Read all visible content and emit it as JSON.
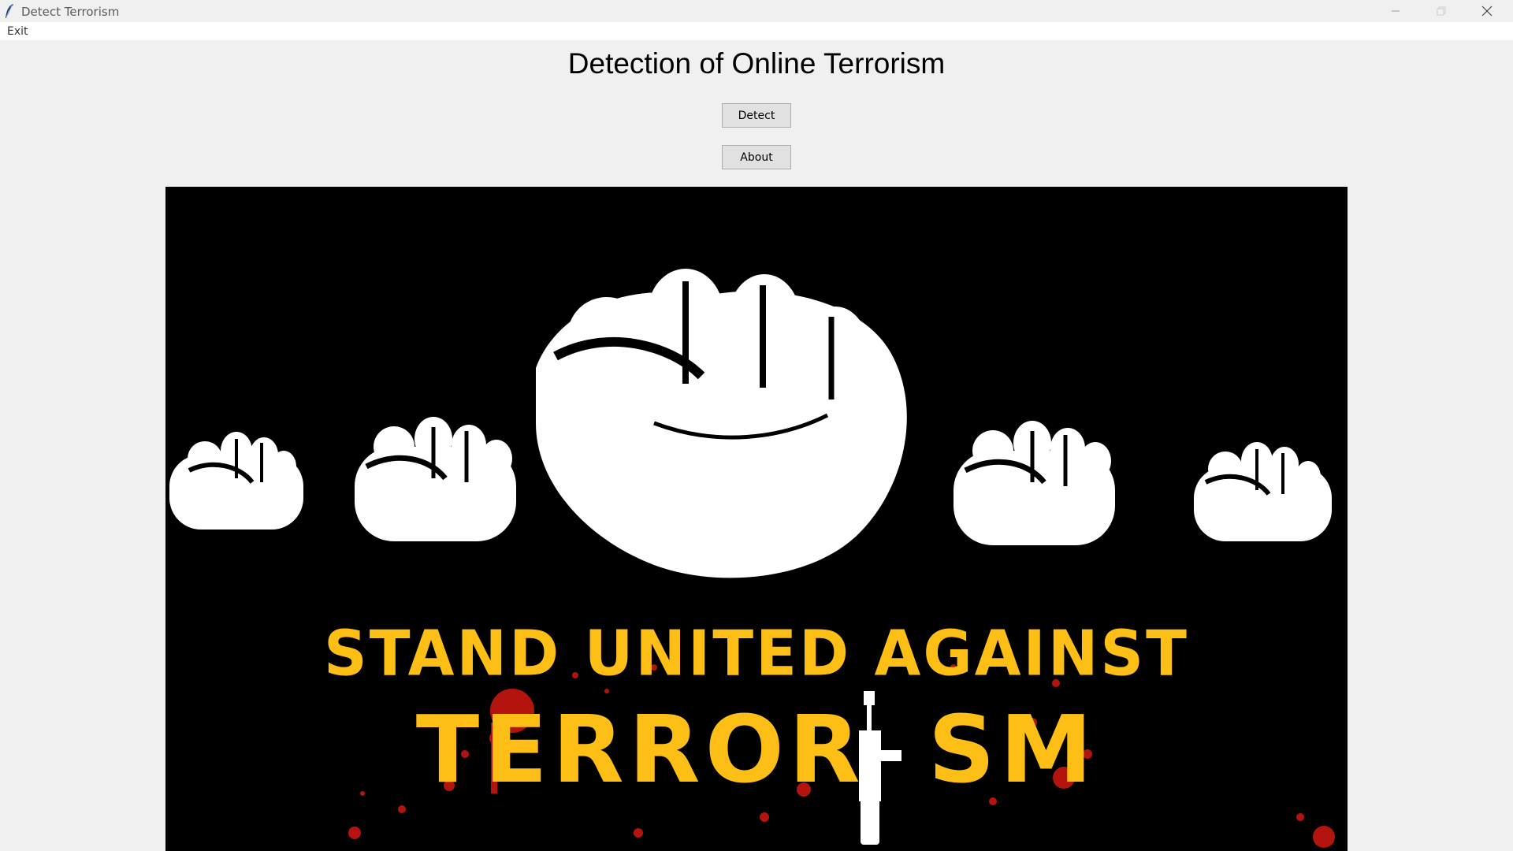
{
  "window": {
    "title": "Detect Terrorism",
    "app_icon": "feather-icon",
    "controls": [
      "minimize-icon",
      "maximize-icon",
      "close-icon"
    ]
  },
  "menubar": {
    "items": [
      {
        "label": "Exit"
      }
    ]
  },
  "main": {
    "heading": "Detection of Online Terrorism",
    "buttons": {
      "detect_label": "Detect",
      "about_label": "About"
    }
  },
  "banner": {
    "line1": "STAND UNITED AGAINST",
    "line2": "TERROR",
    "line2_end": "SM",
    "colors": {
      "background": "#000000",
      "text": "#fdbf16",
      "fists": "#ffffff",
      "blood": "#b3140e"
    }
  },
  "colors": {
    "window_bg": "#f0f0f0",
    "button_bg": "#e1e1e1",
    "button_border": "#adadad"
  }
}
